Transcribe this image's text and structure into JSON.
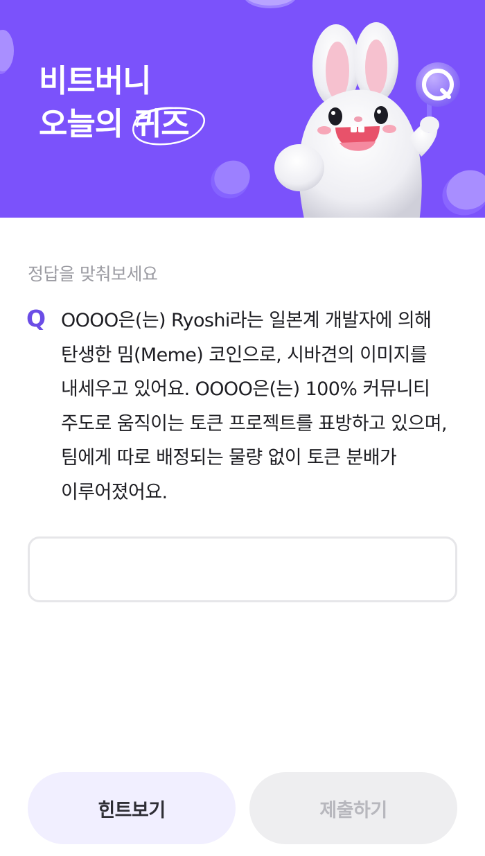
{
  "banner": {
    "title_line1": "비트버니",
    "title_line2_prefix": "오늘의 ",
    "title_line2_circled": "퀴즈",
    "sign_letter": "Q",
    "colors": {
      "background": "#7b52fb",
      "accent": "#6b4de6"
    }
  },
  "quiz": {
    "section_label": "정답을 맞춰보세요",
    "q_label": "Q",
    "question": "OOOO은(는) Ryoshi라는 일본계 개발자에 의해 탄생한 밈(Meme) 코인으로, 시바견의 이미지를 내세우고 있어요. OOOO은(는) 100% 커뮤니티 주도로 움직이는 토큰 프로젝트를 표방하고 있으며, 팀에게 따로 배정되는 물량 없이 토큰 분배가 이루어졌어요."
  },
  "answer": {
    "value": "",
    "placeholder": ""
  },
  "buttons": {
    "hint_label": "힌트보기",
    "submit_label": "제출하기"
  }
}
